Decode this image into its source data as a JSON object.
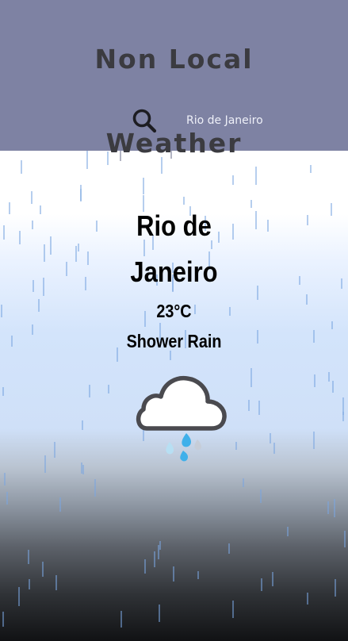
{
  "header": {
    "title_line1": "Non Local",
    "title_line2": "Weather",
    "search_icon": "search-icon",
    "search_value": "Rio de Janeiro",
    "background_color": "#7e82a3"
  },
  "weather": {
    "city_line1": "Rio de",
    "city_line2": "Janeiro",
    "temperature": "23°C",
    "description": "Shower Rain",
    "icon": "cloud-rain-icon"
  },
  "colors": {
    "title": "#3b3b40",
    "rain_streak": "#7aa6e0",
    "raindrop_blue": "#3fb0ea",
    "raindrop_light": "#c6cdd8"
  }
}
